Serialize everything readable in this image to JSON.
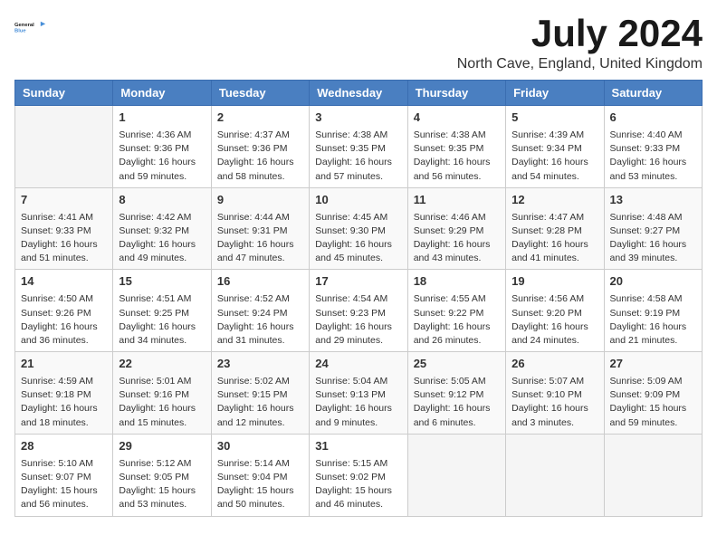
{
  "logo": {
    "text_general": "General",
    "text_blue": "Blue"
  },
  "title": "July 2024",
  "location": "North Cave, England, United Kingdom",
  "days_of_week": [
    "Sunday",
    "Monday",
    "Tuesday",
    "Wednesday",
    "Thursday",
    "Friday",
    "Saturday"
  ],
  "weeks": [
    [
      {
        "day": "",
        "info": ""
      },
      {
        "day": "1",
        "info": "Sunrise: 4:36 AM\nSunset: 9:36 PM\nDaylight: 16 hours\nand 59 minutes."
      },
      {
        "day": "2",
        "info": "Sunrise: 4:37 AM\nSunset: 9:36 PM\nDaylight: 16 hours\nand 58 minutes."
      },
      {
        "day": "3",
        "info": "Sunrise: 4:38 AM\nSunset: 9:35 PM\nDaylight: 16 hours\nand 57 minutes."
      },
      {
        "day": "4",
        "info": "Sunrise: 4:38 AM\nSunset: 9:35 PM\nDaylight: 16 hours\nand 56 minutes."
      },
      {
        "day": "5",
        "info": "Sunrise: 4:39 AM\nSunset: 9:34 PM\nDaylight: 16 hours\nand 54 minutes."
      },
      {
        "day": "6",
        "info": "Sunrise: 4:40 AM\nSunset: 9:33 PM\nDaylight: 16 hours\nand 53 minutes."
      }
    ],
    [
      {
        "day": "7",
        "info": "Sunrise: 4:41 AM\nSunset: 9:33 PM\nDaylight: 16 hours\nand 51 minutes."
      },
      {
        "day": "8",
        "info": "Sunrise: 4:42 AM\nSunset: 9:32 PM\nDaylight: 16 hours\nand 49 minutes."
      },
      {
        "day": "9",
        "info": "Sunrise: 4:44 AM\nSunset: 9:31 PM\nDaylight: 16 hours\nand 47 minutes."
      },
      {
        "day": "10",
        "info": "Sunrise: 4:45 AM\nSunset: 9:30 PM\nDaylight: 16 hours\nand 45 minutes."
      },
      {
        "day": "11",
        "info": "Sunrise: 4:46 AM\nSunset: 9:29 PM\nDaylight: 16 hours\nand 43 minutes."
      },
      {
        "day": "12",
        "info": "Sunrise: 4:47 AM\nSunset: 9:28 PM\nDaylight: 16 hours\nand 41 minutes."
      },
      {
        "day": "13",
        "info": "Sunrise: 4:48 AM\nSunset: 9:27 PM\nDaylight: 16 hours\nand 39 minutes."
      }
    ],
    [
      {
        "day": "14",
        "info": "Sunrise: 4:50 AM\nSunset: 9:26 PM\nDaylight: 16 hours\nand 36 minutes."
      },
      {
        "day": "15",
        "info": "Sunrise: 4:51 AM\nSunset: 9:25 PM\nDaylight: 16 hours\nand 34 minutes."
      },
      {
        "day": "16",
        "info": "Sunrise: 4:52 AM\nSunset: 9:24 PM\nDaylight: 16 hours\nand 31 minutes."
      },
      {
        "day": "17",
        "info": "Sunrise: 4:54 AM\nSunset: 9:23 PM\nDaylight: 16 hours\nand 29 minutes."
      },
      {
        "day": "18",
        "info": "Sunrise: 4:55 AM\nSunset: 9:22 PM\nDaylight: 16 hours\nand 26 minutes."
      },
      {
        "day": "19",
        "info": "Sunrise: 4:56 AM\nSunset: 9:20 PM\nDaylight: 16 hours\nand 24 minutes."
      },
      {
        "day": "20",
        "info": "Sunrise: 4:58 AM\nSunset: 9:19 PM\nDaylight: 16 hours\nand 21 minutes."
      }
    ],
    [
      {
        "day": "21",
        "info": "Sunrise: 4:59 AM\nSunset: 9:18 PM\nDaylight: 16 hours\nand 18 minutes."
      },
      {
        "day": "22",
        "info": "Sunrise: 5:01 AM\nSunset: 9:16 PM\nDaylight: 16 hours\nand 15 minutes."
      },
      {
        "day": "23",
        "info": "Sunrise: 5:02 AM\nSunset: 9:15 PM\nDaylight: 16 hours\nand 12 minutes."
      },
      {
        "day": "24",
        "info": "Sunrise: 5:04 AM\nSunset: 9:13 PM\nDaylight: 16 hours\nand 9 minutes."
      },
      {
        "day": "25",
        "info": "Sunrise: 5:05 AM\nSunset: 9:12 PM\nDaylight: 16 hours\nand 6 minutes."
      },
      {
        "day": "26",
        "info": "Sunrise: 5:07 AM\nSunset: 9:10 PM\nDaylight: 16 hours\nand 3 minutes."
      },
      {
        "day": "27",
        "info": "Sunrise: 5:09 AM\nSunset: 9:09 PM\nDaylight: 15 hours\nand 59 minutes."
      }
    ],
    [
      {
        "day": "28",
        "info": "Sunrise: 5:10 AM\nSunset: 9:07 PM\nDaylight: 15 hours\nand 56 minutes."
      },
      {
        "day": "29",
        "info": "Sunrise: 5:12 AM\nSunset: 9:05 PM\nDaylight: 15 hours\nand 53 minutes."
      },
      {
        "day": "30",
        "info": "Sunrise: 5:14 AM\nSunset: 9:04 PM\nDaylight: 15 hours\nand 50 minutes."
      },
      {
        "day": "31",
        "info": "Sunrise: 5:15 AM\nSunset: 9:02 PM\nDaylight: 15 hours\nand 46 minutes."
      },
      {
        "day": "",
        "info": ""
      },
      {
        "day": "",
        "info": ""
      },
      {
        "day": "",
        "info": ""
      }
    ]
  ]
}
